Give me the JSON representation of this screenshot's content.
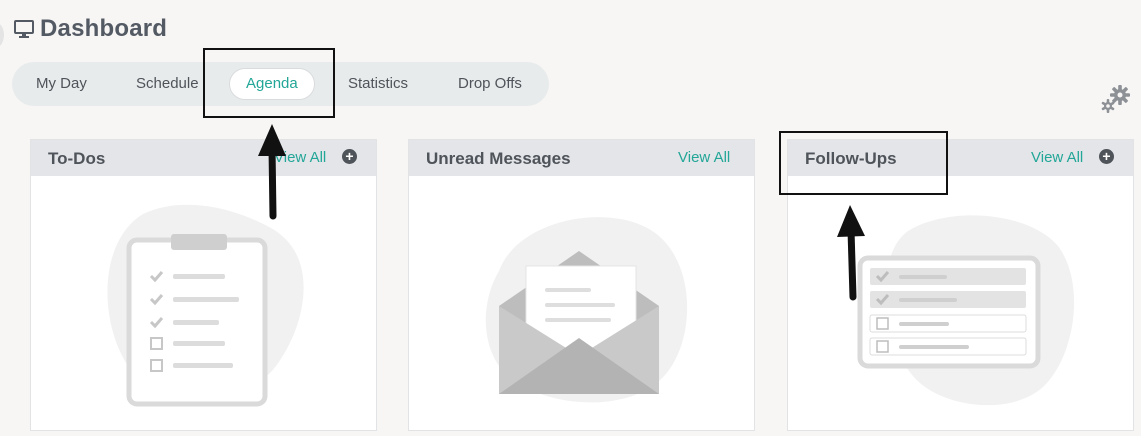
{
  "header": {
    "title": "Dashboard",
    "icon": "monitor-icon"
  },
  "tabs": [
    {
      "label": "My Day"
    },
    {
      "label": "Schedule"
    },
    {
      "label": "Agenda",
      "active": true
    },
    {
      "label": "Statistics"
    },
    {
      "label": "Drop Offs"
    }
  ],
  "colors": {
    "accent": "#22a697",
    "text": "#4f545a",
    "card_header": "#e3e5e9"
  },
  "cards": [
    {
      "title": "To-Dos",
      "link": "View All",
      "has_add": true,
      "illustration": "clipboard-checklist-illustration"
    },
    {
      "title": "Unread Messages",
      "link": "View All",
      "has_add": false,
      "illustration": "envelope-illustration"
    },
    {
      "title": "Follow-Ups",
      "link": "View All",
      "has_add": true,
      "illustration": "follow-up-list-illustration"
    }
  ],
  "toolbar": {
    "settings_icon": "gears-icon"
  }
}
